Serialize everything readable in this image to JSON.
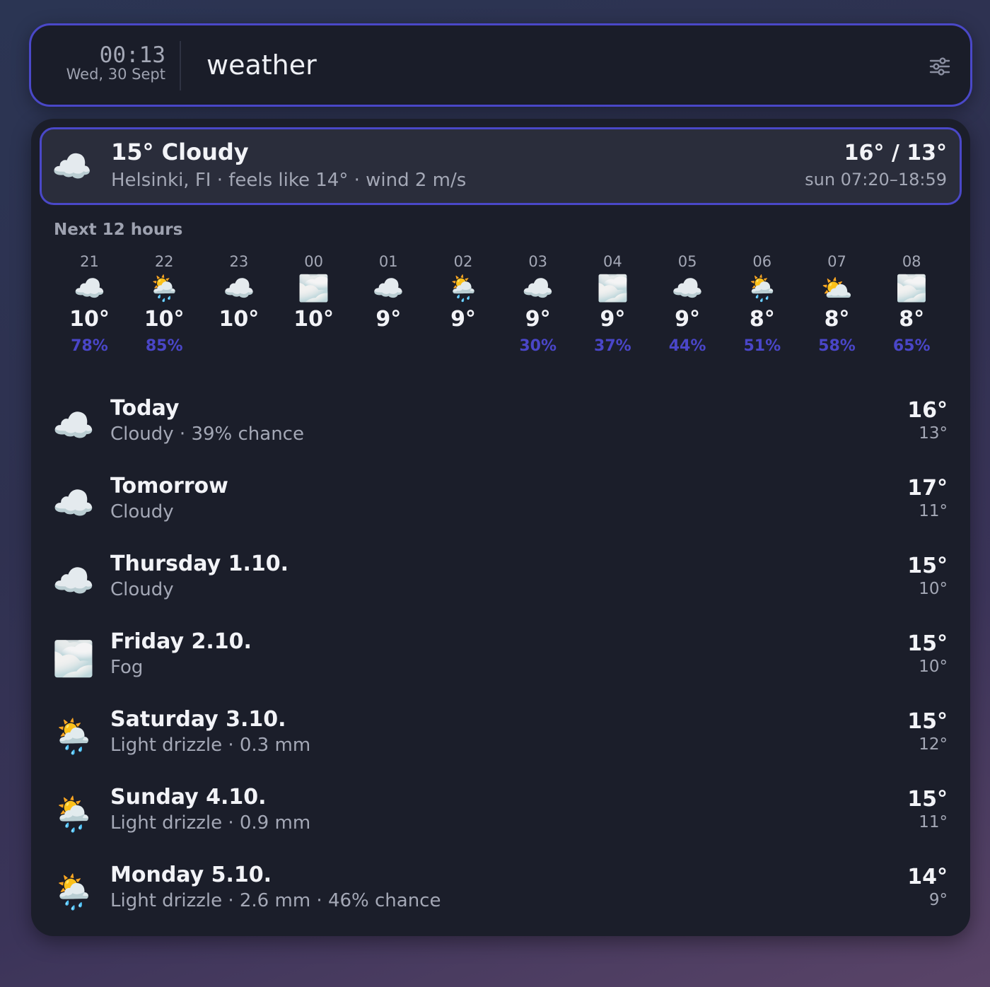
{
  "search": {
    "time": "00:13",
    "date": "Wed, 30 Sept",
    "query": "weather",
    "filter_icon": "sliders-icon"
  },
  "current": {
    "icon": "☁️",
    "title": "15° Cloudy",
    "subtitle": "Helsinki, FI · feels like 14° · wind 2 m/s",
    "high_low": "16° / 13°",
    "sun": "sun 07:20–18:59"
  },
  "hourly": {
    "title": "Next 12 hours",
    "items": [
      {
        "time": "21",
        "icon": "☁️",
        "temp": "10°",
        "pop": "78%"
      },
      {
        "time": "22",
        "icon": "🌦️",
        "temp": "10°",
        "pop": "85%"
      },
      {
        "time": "23",
        "icon": "☁️",
        "temp": "10°",
        "pop": ""
      },
      {
        "time": "00",
        "icon": "🌫️",
        "temp": "10°",
        "pop": ""
      },
      {
        "time": "01",
        "icon": "☁️",
        "temp": "9°",
        "pop": ""
      },
      {
        "time": "02",
        "icon": "🌦️",
        "temp": "9°",
        "pop": ""
      },
      {
        "time": "03",
        "icon": "☁️",
        "temp": "9°",
        "pop": "30%"
      },
      {
        "time": "04",
        "icon": "🌫️",
        "temp": "9°",
        "pop": "37%"
      },
      {
        "time": "05",
        "icon": "☁️",
        "temp": "9°",
        "pop": "44%"
      },
      {
        "time": "06",
        "icon": "🌦️",
        "temp": "8°",
        "pop": "51%"
      },
      {
        "time": "07",
        "icon": "⛅",
        "temp": "8°",
        "pop": "58%"
      },
      {
        "time": "08",
        "icon": "🌫️",
        "temp": "8°",
        "pop": "65%"
      }
    ]
  },
  "daily": [
    {
      "icon": "☁️",
      "name": "Today",
      "desc": "Cloudy · 39% chance",
      "high": "16°",
      "low": "13°"
    },
    {
      "icon": "☁️",
      "name": "Tomorrow",
      "desc": "Cloudy",
      "high": "17°",
      "low": "11°"
    },
    {
      "icon": "☁️",
      "name": "Thursday 1.10.",
      "desc": "Cloudy",
      "high": "15°",
      "low": "10°"
    },
    {
      "icon": "🌫️",
      "name": "Friday 2.10.",
      "desc": "Fog",
      "high": "15°",
      "low": "10°"
    },
    {
      "icon": "🌦️",
      "name": "Saturday 3.10.",
      "desc": "Light drizzle · 0.3 mm",
      "high": "15°",
      "low": "12°"
    },
    {
      "icon": "🌦️",
      "name": "Sunday 4.10.",
      "desc": "Light drizzle · 0.9 mm",
      "high": "15°",
      "low": "11°"
    },
    {
      "icon": "🌦️",
      "name": "Monday 5.10.",
      "desc": "Light drizzle · 2.6 mm · 46% chance",
      "high": "14°",
      "low": "9°"
    }
  ]
}
